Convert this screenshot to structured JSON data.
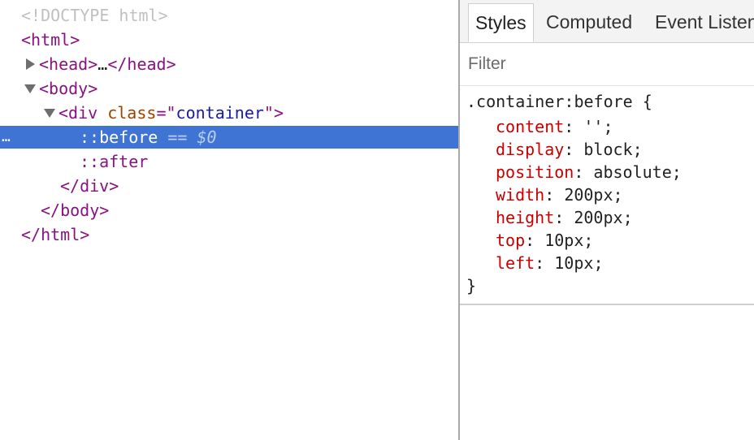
{
  "elements_tree": {
    "doctype": "<!DOCTYPE html>",
    "html_open": "html",
    "head_tag": "head",
    "head_ellipsis": "…",
    "head_close": "/head",
    "body_open": "body",
    "div_tag": "div",
    "div_attr_name": "class",
    "div_attr_value": "container",
    "before_label": "::before",
    "before_eq": "==",
    "before_ref": "$0",
    "after_label": "::after",
    "div_close": "/div",
    "body_close": "/body",
    "html_close": "/html",
    "row_ellipsis": "…"
  },
  "styles_panel": {
    "tabs": [
      {
        "label": "Styles",
        "active": true
      },
      {
        "label": "Computed",
        "active": false
      },
      {
        "label": "Event Listeners",
        "active": false
      }
    ],
    "filter_placeholder": "Filter",
    "rule": {
      "selector": ".container:before",
      "open_brace": "{",
      "close_brace": "}",
      "declarations": [
        {
          "property": "content",
          "value": "''"
        },
        {
          "property": "display",
          "value": "block"
        },
        {
          "property": "position",
          "value": "absolute"
        },
        {
          "property": "width",
          "value": "200px"
        },
        {
          "property": "height",
          "value": "200px"
        },
        {
          "property": "top",
          "value": "10px"
        },
        {
          "property": "left",
          "value": "10px"
        }
      ]
    }
  },
  "colors": {
    "tag": "#881280",
    "attribute_name": "#994500",
    "attribute_value": "#1a1aa6",
    "css_property": "#c80000",
    "selection": "#3f74d4"
  }
}
